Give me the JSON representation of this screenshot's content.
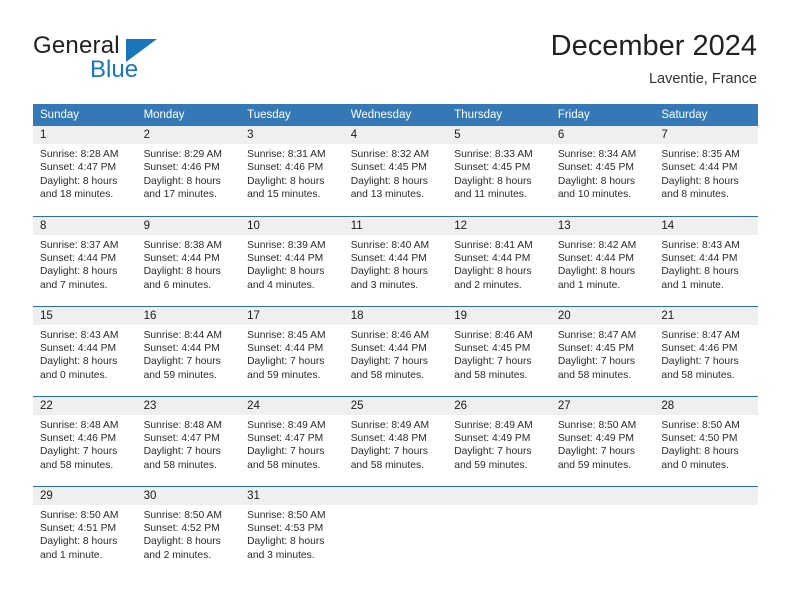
{
  "brand": {
    "name_top": "General",
    "name_bottom": "Blue",
    "triangle_color": "#1b75bb",
    "text_color": "#231f20"
  },
  "header": {
    "title": "December 2024",
    "subtitle": "Laventie, France"
  },
  "theme": {
    "header_blue": "#3478b5",
    "rule_blue": "#2f6fae",
    "band_gray": "#efefef",
    "text": "#1a1a1a"
  },
  "calendar": {
    "weekday_headers": [
      "Sunday",
      "Monday",
      "Tuesday",
      "Wednesday",
      "Thursday",
      "Friday",
      "Saturday"
    ],
    "weeks": [
      [
        {
          "day": "1",
          "sunrise": "Sunrise: 8:28 AM",
          "sunset": "Sunset: 4:47 PM",
          "daylight_line1": "Daylight: 8 hours",
          "daylight_line2": "and 18 minutes."
        },
        {
          "day": "2",
          "sunrise": "Sunrise: 8:29 AM",
          "sunset": "Sunset: 4:46 PM",
          "daylight_line1": "Daylight: 8 hours",
          "daylight_line2": "and 17 minutes."
        },
        {
          "day": "3",
          "sunrise": "Sunrise: 8:31 AM",
          "sunset": "Sunset: 4:46 PM",
          "daylight_line1": "Daylight: 8 hours",
          "daylight_line2": "and 15 minutes."
        },
        {
          "day": "4",
          "sunrise": "Sunrise: 8:32 AM",
          "sunset": "Sunset: 4:45 PM",
          "daylight_line1": "Daylight: 8 hours",
          "daylight_line2": "and 13 minutes."
        },
        {
          "day": "5",
          "sunrise": "Sunrise: 8:33 AM",
          "sunset": "Sunset: 4:45 PM",
          "daylight_line1": "Daylight: 8 hours",
          "daylight_line2": "and 11 minutes."
        },
        {
          "day": "6",
          "sunrise": "Sunrise: 8:34 AM",
          "sunset": "Sunset: 4:45 PM",
          "daylight_line1": "Daylight: 8 hours",
          "daylight_line2": "and 10 minutes."
        },
        {
          "day": "7",
          "sunrise": "Sunrise: 8:35 AM",
          "sunset": "Sunset: 4:44 PM",
          "daylight_line1": "Daylight: 8 hours",
          "daylight_line2": "and 8 minutes."
        }
      ],
      [
        {
          "day": "8",
          "sunrise": "Sunrise: 8:37 AM",
          "sunset": "Sunset: 4:44 PM",
          "daylight_line1": "Daylight: 8 hours",
          "daylight_line2": "and 7 minutes."
        },
        {
          "day": "9",
          "sunrise": "Sunrise: 8:38 AM",
          "sunset": "Sunset: 4:44 PM",
          "daylight_line1": "Daylight: 8 hours",
          "daylight_line2": "and 6 minutes."
        },
        {
          "day": "10",
          "sunrise": "Sunrise: 8:39 AM",
          "sunset": "Sunset: 4:44 PM",
          "daylight_line1": "Daylight: 8 hours",
          "daylight_line2": "and 4 minutes."
        },
        {
          "day": "11",
          "sunrise": "Sunrise: 8:40 AM",
          "sunset": "Sunset: 4:44 PM",
          "daylight_line1": "Daylight: 8 hours",
          "daylight_line2": "and 3 minutes."
        },
        {
          "day": "12",
          "sunrise": "Sunrise: 8:41 AM",
          "sunset": "Sunset: 4:44 PM",
          "daylight_line1": "Daylight: 8 hours",
          "daylight_line2": "and 2 minutes."
        },
        {
          "day": "13",
          "sunrise": "Sunrise: 8:42 AM",
          "sunset": "Sunset: 4:44 PM",
          "daylight_line1": "Daylight: 8 hours",
          "daylight_line2": "and 1 minute."
        },
        {
          "day": "14",
          "sunrise": "Sunrise: 8:43 AM",
          "sunset": "Sunset: 4:44 PM",
          "daylight_line1": "Daylight: 8 hours",
          "daylight_line2": "and 1 minute."
        }
      ],
      [
        {
          "day": "15",
          "sunrise": "Sunrise: 8:43 AM",
          "sunset": "Sunset: 4:44 PM",
          "daylight_line1": "Daylight: 8 hours",
          "daylight_line2": "and 0 minutes."
        },
        {
          "day": "16",
          "sunrise": "Sunrise: 8:44 AM",
          "sunset": "Sunset: 4:44 PM",
          "daylight_line1": "Daylight: 7 hours",
          "daylight_line2": "and 59 minutes."
        },
        {
          "day": "17",
          "sunrise": "Sunrise: 8:45 AM",
          "sunset": "Sunset: 4:44 PM",
          "daylight_line1": "Daylight: 7 hours",
          "daylight_line2": "and 59 minutes."
        },
        {
          "day": "18",
          "sunrise": "Sunrise: 8:46 AM",
          "sunset": "Sunset: 4:44 PM",
          "daylight_line1": "Daylight: 7 hours",
          "daylight_line2": "and 58 minutes."
        },
        {
          "day": "19",
          "sunrise": "Sunrise: 8:46 AM",
          "sunset": "Sunset: 4:45 PM",
          "daylight_line1": "Daylight: 7 hours",
          "daylight_line2": "and 58 minutes."
        },
        {
          "day": "20",
          "sunrise": "Sunrise: 8:47 AM",
          "sunset": "Sunset: 4:45 PM",
          "daylight_line1": "Daylight: 7 hours",
          "daylight_line2": "and 58 minutes."
        },
        {
          "day": "21",
          "sunrise": "Sunrise: 8:47 AM",
          "sunset": "Sunset: 4:46 PM",
          "daylight_line1": "Daylight: 7 hours",
          "daylight_line2": "and 58 minutes."
        }
      ],
      [
        {
          "day": "22",
          "sunrise": "Sunrise: 8:48 AM",
          "sunset": "Sunset: 4:46 PM",
          "daylight_line1": "Daylight: 7 hours",
          "daylight_line2": "and 58 minutes."
        },
        {
          "day": "23",
          "sunrise": "Sunrise: 8:48 AM",
          "sunset": "Sunset: 4:47 PM",
          "daylight_line1": "Daylight: 7 hours",
          "daylight_line2": "and 58 minutes."
        },
        {
          "day": "24",
          "sunrise": "Sunrise: 8:49 AM",
          "sunset": "Sunset: 4:47 PM",
          "daylight_line1": "Daylight: 7 hours",
          "daylight_line2": "and 58 minutes."
        },
        {
          "day": "25",
          "sunrise": "Sunrise: 8:49 AM",
          "sunset": "Sunset: 4:48 PM",
          "daylight_line1": "Daylight: 7 hours",
          "daylight_line2": "and 58 minutes."
        },
        {
          "day": "26",
          "sunrise": "Sunrise: 8:49 AM",
          "sunset": "Sunset: 4:49 PM",
          "daylight_line1": "Daylight: 7 hours",
          "daylight_line2": "and 59 minutes."
        },
        {
          "day": "27",
          "sunrise": "Sunrise: 8:50 AM",
          "sunset": "Sunset: 4:49 PM",
          "daylight_line1": "Daylight: 7 hours",
          "daylight_line2": "and 59 minutes."
        },
        {
          "day": "28",
          "sunrise": "Sunrise: 8:50 AM",
          "sunset": "Sunset: 4:50 PM",
          "daylight_line1": "Daylight: 8 hours",
          "daylight_line2": "and 0 minutes."
        }
      ],
      [
        {
          "day": "29",
          "sunrise": "Sunrise: 8:50 AM",
          "sunset": "Sunset: 4:51 PM",
          "daylight_line1": "Daylight: 8 hours",
          "daylight_line2": "and 1 minute."
        },
        {
          "day": "30",
          "sunrise": "Sunrise: 8:50 AM",
          "sunset": "Sunset: 4:52 PM",
          "daylight_line1": "Daylight: 8 hours",
          "daylight_line2": "and 2 minutes."
        },
        {
          "day": "31",
          "sunrise": "Sunrise: 8:50 AM",
          "sunset": "Sunset: 4:53 PM",
          "daylight_line1": "Daylight: 8 hours",
          "daylight_line2": "and 3 minutes."
        },
        {
          "day": "",
          "sunrise": "",
          "sunset": "",
          "daylight_line1": "",
          "daylight_line2": ""
        },
        {
          "day": "",
          "sunrise": "",
          "sunset": "",
          "daylight_line1": "",
          "daylight_line2": ""
        },
        {
          "day": "",
          "sunrise": "",
          "sunset": "",
          "daylight_line1": "",
          "daylight_line2": ""
        },
        {
          "day": "",
          "sunrise": "",
          "sunset": "",
          "daylight_line1": "",
          "daylight_line2": ""
        }
      ]
    ]
  }
}
